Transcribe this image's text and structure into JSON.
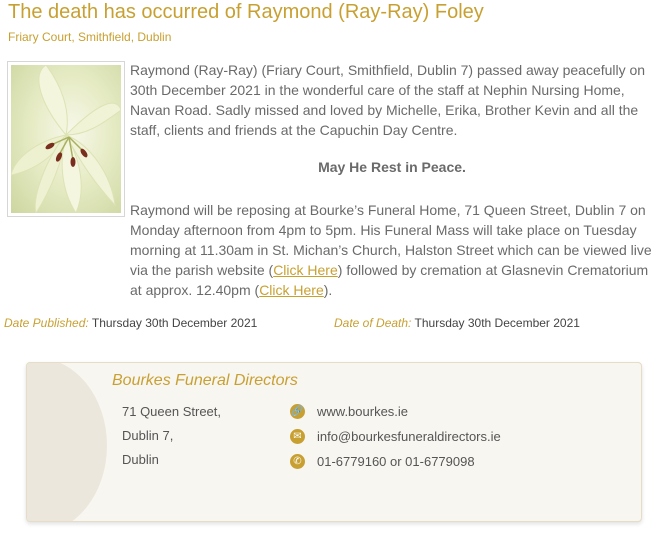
{
  "notice": {
    "title": "The death has occurred of Raymond (Ray-Ray) Foley",
    "location": "Friary Court, Smithfield, Dublin",
    "paragraph1": "Raymond (Ray-Ray) (Friary Court, Smithfield, Dublin 7) passed away peacefully on 30th December 2021 in the wonderful care of the staff at Nephin Nursing Home, Navan Road. Sadly missed and loved by Michelle, Erika, Brother Kevin and all the staff, clients and friends at the Capuchin Day Centre.",
    "rest_line": "May He Rest in Peace.",
    "paragraph2_a": "Raymond will be reposing at Bourke’s Funeral Home, 71 Queen Street, Dublin 7 on Monday afternoon from 4pm to 5pm. His Funeral Mass will take place on Tuesday morning at 11.30am in St. Michan’s Church, Halston Street which can be viewed live via the parish website (",
    "link1": "Click Here",
    "paragraph2_b": ") followed by cremation at Glasnevin Crematorium at approx. 12.40pm (",
    "link2": "Click Here",
    "paragraph2_c": ").",
    "date_published_label": "Date Published:",
    "date_published": "Thursday 30th December 2021",
    "date_of_death_label": "Date of Death:",
    "date_of_death": "Thursday 30th December 2021"
  },
  "funeral_director": {
    "name": "Bourkes Funeral Directors",
    "address_line1": "71 Queen Street,",
    "address_line2": "Dublin 7,",
    "address_line3": "Dublin",
    "website": "www.bourkes.ie",
    "email": "info@bourkesfuneraldirectors.ie",
    "phone": "01-6779160 or 01-6779098",
    "icons": [
      "link-icon",
      "email-icon",
      "phone-icon"
    ]
  },
  "colors": {
    "accent": "#c8a032",
    "text": "#6a6a6a",
    "box_bg": "#f8f6f1"
  }
}
